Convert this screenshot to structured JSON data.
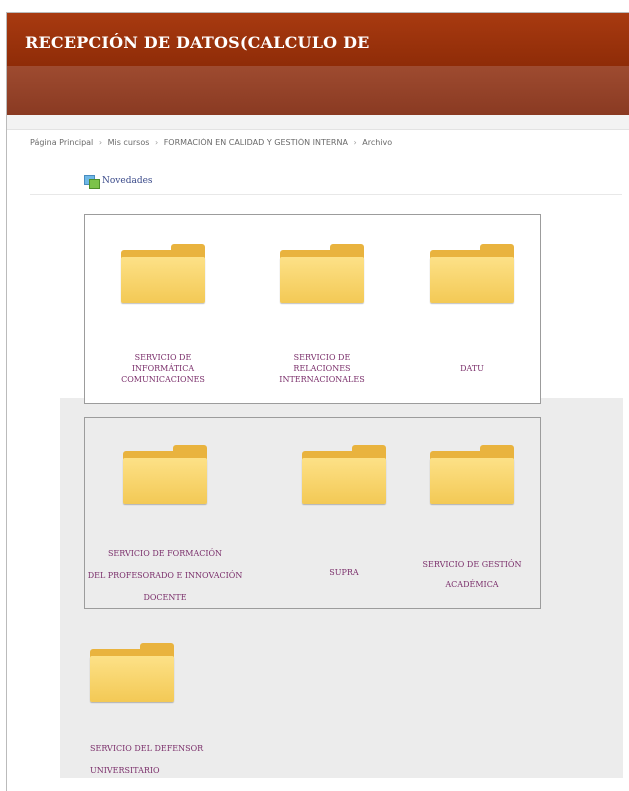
{
  "header": {
    "title": "RECEPCIÓN DE DATOS(CALCULO DE"
  },
  "breadcrumb": [
    "Página Principal",
    "Mis cursos",
    "FORMACIÓN EN CALIDAD Y GESTIÓN INTERNA",
    "Archivo"
  ],
  "module": {
    "label": "Novedades"
  },
  "folders_box1": [
    {
      "lines": [
        "SERVICIO DE",
        "INFORMÁTICA",
        "COMUNICACIONES"
      ]
    },
    {
      "lines": [
        "SERVICIO DE",
        "RELACIONES",
        "INTERNACIONALES"
      ]
    },
    {
      "lines": [
        "DATU"
      ]
    }
  ],
  "folders_box2": [
    {
      "lines": [
        "SERVICIO DE FORMACIÓN",
        "DEL PROFESORADO E INNOVACIÓN",
        "DOCENTE"
      ]
    },
    {
      "lines": [
        "SUPRA"
      ]
    },
    {
      "lines": [
        "SERVICIO DE GESTIÓN",
        "ACADÉMICA"
      ]
    }
  ],
  "folder_single": {
    "lines": [
      "SERVICIO DEL DEFENSOR",
      "UNIVERSITARIO"
    ]
  },
  "colors": {
    "header_bg": "#962f0a",
    "subheader_bg": "#95432a",
    "folder_label": "#7a2e6a",
    "folder_yellow": "#f3c955"
  }
}
